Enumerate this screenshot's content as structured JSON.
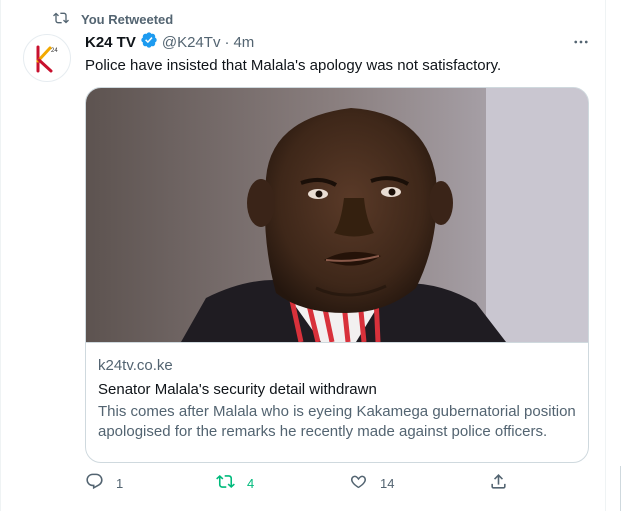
{
  "retweet_context": {
    "label": "You Retweeted",
    "icon": "retweet-icon"
  },
  "author": {
    "name": "K24 TV",
    "handle": "@K24Tv",
    "separator": "·",
    "time": "4m",
    "verified": true,
    "avatar_mark": "24"
  },
  "tweet": {
    "text": "Police have insisted that Malala's apology was not satisfactory."
  },
  "card": {
    "domain": "k24tv.co.ke",
    "title": "Senator Malala's security detail withdrawn",
    "description": "This comes after Malala who is eyeing Kakamega gubernatorial position apologised for the remarks he recently made against police officers."
  },
  "actions": {
    "reply_count": "1",
    "retweet_count": "4",
    "like_count": "14"
  },
  "colors": {
    "accent": "#1d9bf0",
    "retweet_green": "#00ba7c",
    "muted": "#536471"
  }
}
